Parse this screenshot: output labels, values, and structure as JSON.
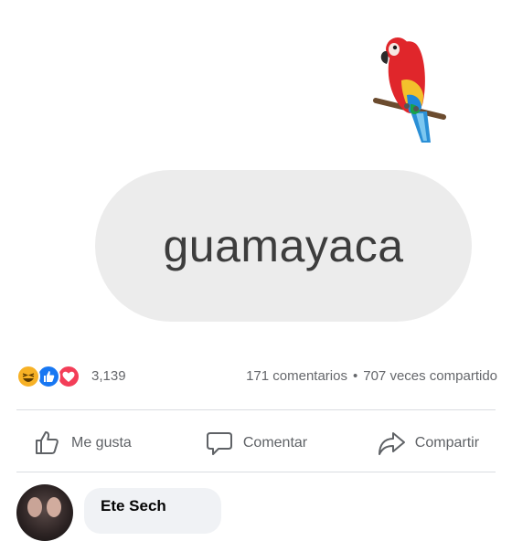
{
  "post": {
    "bubble_text": "guamayaca",
    "emoji_icon": "parrot-emoji"
  },
  "stats": {
    "reaction_icons": [
      "haha-icon",
      "like-icon",
      "love-icon"
    ],
    "reaction_count": "3,139",
    "comments": "171 comentarios",
    "separator": "•",
    "shares": "707 veces compartido"
  },
  "actions": {
    "like_label": "Me gusta",
    "comment_label": "Comentar",
    "share_label": "Compartir"
  },
  "comment": {
    "author": "Ete Sech"
  },
  "colors": {
    "like": "#1877f2",
    "love": "#f33e58",
    "haha": "#f7b125",
    "bubble_bg": "#ececec",
    "muted_text": "#65676b"
  }
}
